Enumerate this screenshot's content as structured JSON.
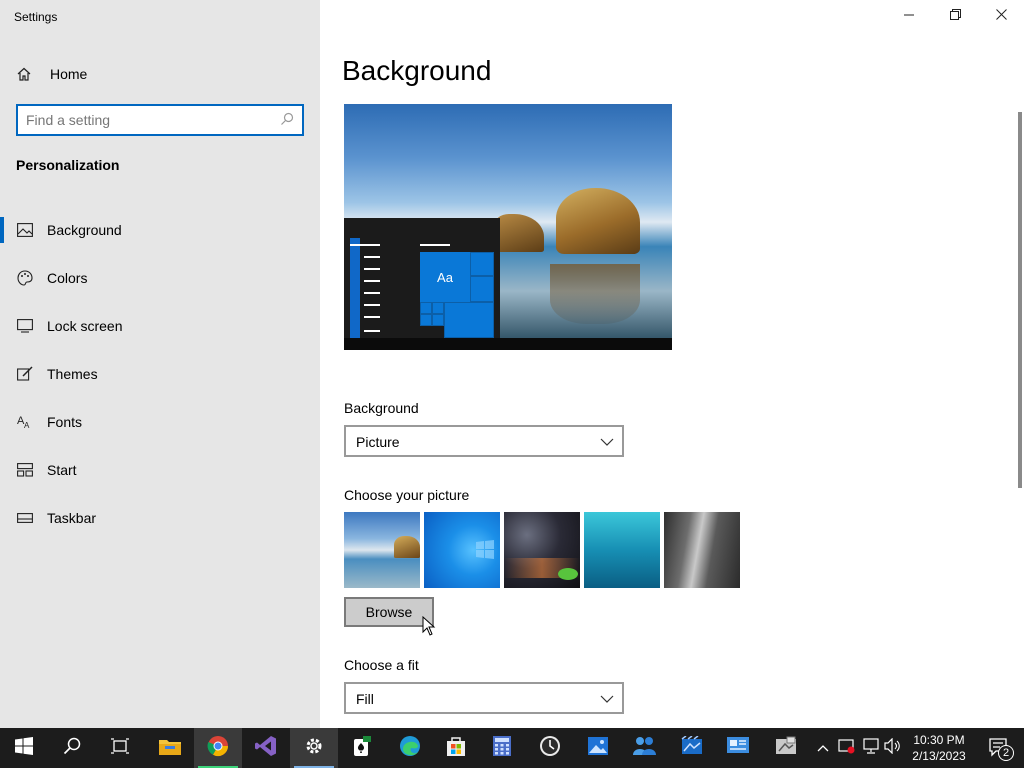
{
  "window": {
    "title": "Settings",
    "minimize_icon": "minimize-icon",
    "maximize_icon": "restore-icon",
    "close_icon": "close-icon"
  },
  "sidebar": {
    "home_label": "Home",
    "search_placeholder": "Find a setting",
    "section_title": "Personalization",
    "items": [
      {
        "label": "Background",
        "icon": "picture-icon",
        "active": true
      },
      {
        "label": "Colors",
        "icon": "palette-icon",
        "active": false
      },
      {
        "label": "Lock screen",
        "icon": "lock-screen-icon",
        "active": false
      },
      {
        "label": "Themes",
        "icon": "brush-icon",
        "active": false
      },
      {
        "label": "Fonts",
        "icon": "font-icon",
        "active": false
      },
      {
        "label": "Start",
        "icon": "start-tiles-icon",
        "active": false
      },
      {
        "label": "Taskbar",
        "icon": "taskbar-icon",
        "active": false
      }
    ]
  },
  "main": {
    "title": "Background",
    "preview": {
      "tile_label": "Aa"
    },
    "background_label": "Background",
    "background_value": "Picture",
    "choose_picture_label": "Choose your picture",
    "browse_label": "Browse",
    "fit_label": "Choose a fit",
    "fit_value": "Fill"
  },
  "taskbar": {
    "apps": [
      "windows-start-icon",
      "search-icon",
      "task-view-icon",
      "file-explorer-icon",
      "chrome-icon",
      "visual-studio-icon",
      "settings-icon",
      "solitaire-icon",
      "edge-icon",
      "store-icon",
      "calculator-icon",
      "alarms-clock-icon",
      "photos-icon",
      "people-icon",
      "movies-tv-icon",
      "app-icon",
      "screen-snip-icon"
    ],
    "time": "10:30 PM",
    "date": "2/13/2023",
    "notification_count": "2"
  },
  "colors": {
    "accent": "#0067c0",
    "sidebar_bg": "#e6e6e6",
    "taskbar_bg": "#1c1c1c"
  }
}
